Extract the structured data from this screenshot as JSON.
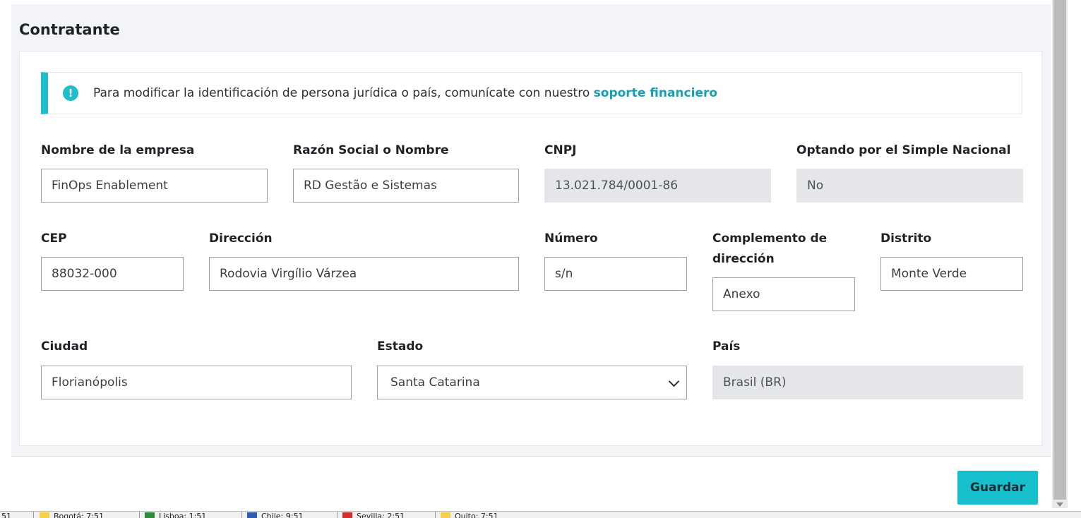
{
  "section": {
    "title": "Contratante",
    "alert": {
      "icon": "exclamation-circle-icon",
      "text": "Para modificar la identificación de persona jurídica o país, comunícate con nuestro ",
      "link_text": "soporte financiero"
    }
  },
  "form": {
    "empresa": {
      "label": "Nombre de la empresa",
      "value": "FinOps Enablement"
    },
    "razon_social": {
      "label": "Razón Social o Nombre",
      "value": "RD Gestão e Sistemas"
    },
    "cnpj": {
      "label": "CNPJ",
      "value": "13.021.784/0001-86"
    },
    "simples": {
      "label": "Optando por el Simple Nacional",
      "value": "No"
    },
    "cep": {
      "label": "CEP",
      "value": "88032-000"
    },
    "direccion": {
      "label": "Dirección",
      "value": "Rodovia Virgílio Várzea"
    },
    "numero": {
      "label": "Número",
      "value": "s/n"
    },
    "complemento": {
      "label_line1": "Complemento de",
      "label_line2": "dirección",
      "value": "Anexo"
    },
    "distrito": {
      "label": "Distrito",
      "value": "Monte Verde"
    },
    "ciudad": {
      "label": "Ciudad",
      "value": "Florianópolis"
    },
    "estado": {
      "label": "Estado",
      "value": "Santa Catarina"
    },
    "pais": {
      "label": "País",
      "value": "Brasil (BR)"
    }
  },
  "footer": {
    "save_label": "Guardar"
  },
  "taskbar": {
    "items": [
      {
        "label": "51",
        "color": "#f0f0f0"
      },
      {
        "label": "Bogotá: 7:51",
        "color": "#f5d14a"
      },
      {
        "label": "Lisboa: 1:51",
        "color": "#2e8b3a"
      },
      {
        "label": "Chile: 9:51",
        "color": "#2a5db0"
      },
      {
        "label": "Sevilla: 2:51",
        "color": "#d32f2f"
      },
      {
        "label": "Quito: 7:51",
        "color": "#f5d14a"
      }
    ]
  },
  "colors": {
    "accent": "#17bfcc",
    "link": "#1a9fb0",
    "disabled_bg": "#e4e6e9"
  }
}
